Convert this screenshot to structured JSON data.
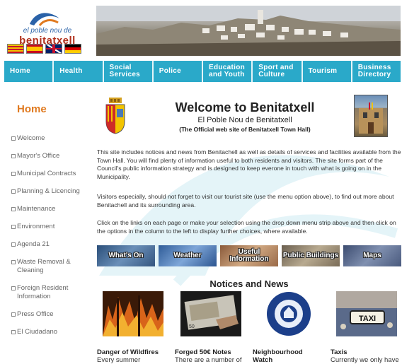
{
  "logo": {
    "line1": "el poble nou de",
    "line2": "benitatxell"
  },
  "languages": [
    "valencian-flag",
    "spanish-flag",
    "english-flag",
    "german-flag"
  ],
  "nav": [
    {
      "label": "Home"
    },
    {
      "label": "Health"
    },
    {
      "label": "Social Services"
    },
    {
      "label": "Police"
    },
    {
      "label": "Education and Youth"
    },
    {
      "label": "Sport and Culture"
    },
    {
      "label": "Tourism"
    },
    {
      "label": "Business Directory"
    }
  ],
  "sidebar": {
    "title": "Home",
    "items": [
      {
        "label": "Welcome"
      },
      {
        "label": "Mayor's Office"
      },
      {
        "label": "Municipal Contracts"
      },
      {
        "label": "Planning & Licencing"
      },
      {
        "label": "Maintenance"
      },
      {
        "label": "Environment"
      },
      {
        "label": "Agenda 21"
      },
      {
        "label": "Waste Removal & Cleaning"
      },
      {
        "label": "Foreign Resident Information"
      },
      {
        "label": "Press Office"
      },
      {
        "label": "El Ciudadano"
      }
    ]
  },
  "main": {
    "title": "Welcome to Benitatxell",
    "subtitle": "El Poble Nou de Benitatxell",
    "official": "(The Official web site of Benitatxell Town Hall)",
    "paragraphs": [
      "This site includes notices and news from Benitachell as well as details of services and facilities available from the Town Hall. You will find plenty of information useful to both residents and visitors. The site forms part of the Council's public information strategy and is designed to keep everone in touch with what is going on in the Municipality.",
      "Visitors especially, should not forget to visit our tourist site (use the menu option above), to find out more about Benitachell and its surrounding area.",
      "Click on the links on each page or make your selection using the drop down menu strip above and then click on the options in the column to the left to display further choices, where available."
    ],
    "quick_links": [
      {
        "label": "What's On",
        "color": "#4a6f9a"
      },
      {
        "label": "Weather",
        "color": "#3d6ca8"
      },
      {
        "label": "Useful Information",
        "color": "#b07a55"
      },
      {
        "label": "Public Buildings",
        "color": "#9a8a70"
      },
      {
        "label": "Maps",
        "color": "#5a6a8a"
      }
    ],
    "news_heading": "Notices and News",
    "news": [
      {
        "title": "Danger of Wildfires",
        "desc": "Every summer"
      },
      {
        "title": "Forged 50€ Notes",
        "desc": "There are a number of"
      },
      {
        "title": "Neighbourhood Watch",
        "desc": ""
      },
      {
        "title": "Taxis",
        "desc": "Currently we only have"
      }
    ],
    "badge_text": "VEINOS COOPERANDO",
    "badge_sub": "POLICIA LOCAL",
    "taxi_sign": "TAXI"
  }
}
